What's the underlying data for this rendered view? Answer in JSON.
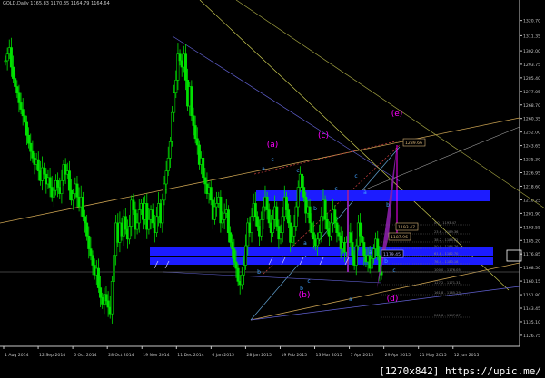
{
  "header": {
    "text": "GOLD,Daily  1165.83 1170.35 1164.79 1164.64"
  },
  "watermark": "[1270x842] https://upic.me/",
  "chart_data": {
    "type": "candlestick",
    "symbol": "GOLD",
    "timeframe": "Daily",
    "ohlc": {
      "open": 1165.83,
      "high": 1170.35,
      "low": 1164.79,
      "close": 1164.64
    },
    "ylim": [
      1120,
      1330
    ],
    "y_ticks": [
      "1320.70",
      "1311.35",
      "1302.00",
      "1293.75",
      "1285.40",
      "1277.05",
      "1268.70",
      "1260.35",
      "1252.00",
      "1243.65",
      "1235.30",
      "1226.95",
      "1218.60",
      "1210.25",
      "1201.90",
      "1193.55",
      "1185.20",
      "1176.85",
      "1168.50",
      "1160.15",
      "1151.80",
      "1143.45",
      "1135.10",
      "1126.75"
    ],
    "x_ticks": [
      "1 Aug 2014",
      "12 Sep 2014",
      "6 Oct 2014",
      "28 Oct 2014",
      "19 Nov 2014",
      "11 Dec 2014",
      "6 Jan 2015",
      "28 Jan 2015",
      "19 Feb 2015",
      "13 Mar 2015",
      "7 Apr 2015",
      "29 Apr 2015",
      "21 May 2015",
      "12 Jun 2015"
    ],
    "closes": [
      1296,
      1300,
      1304,
      1292,
      1285,
      1280,
      1276,
      1270,
      1266,
      1262,
      1258,
      1250,
      1245,
      1240,
      1236,
      1232,
      1235,
      1228,
      1222,
      1230,
      1226,
      1220,
      1224,
      1218,
      1212,
      1216,
      1222,
      1218,
      1214,
      1222,
      1232,
      1226,
      1228,
      1216,
      1210,
      1214,
      1220,
      1212,
      1206,
      1212,
      1200,
      1196,
      1188,
      1180,
      1176,
      1170,
      1164,
      1168,
      1156,
      1150,
      1146,
      1152,
      1148,
      1144,
      1140,
      1160,
      1176,
      1196,
      1184,
      1196,
      1188,
      1200,
      1192,
      1186,
      1194,
      1210,
      1204,
      1192,
      1196,
      1204,
      1208,
      1198,
      1208,
      1192,
      1198,
      1204,
      1196,
      1190,
      1200,
      1208,
      1196,
      1210,
      1220,
      1228,
      1236,
      1246,
      1264,
      1276,
      1284,
      1300,
      1296,
      1292,
      1300,
      1284,
      1268,
      1280,
      1262,
      1256,
      1248,
      1244,
      1232,
      1236,
      1224,
      1220,
      1214,
      1218,
      1210,
      1198,
      1206,
      1208,
      1212,
      1196,
      1198,
      1202,
      1204,
      1190,
      1184,
      1180,
      1172,
      1168,
      1160,
      1158,
      1164,
      1170,
      1182,
      1196,
      1190,
      1200,
      1208,
      1200,
      1194,
      1188,
      1198,
      1206,
      1212,
      1204,
      1196,
      1190,
      1198,
      1206,
      1194,
      1186,
      1190,
      1200,
      1212,
      1204,
      1196,
      1184,
      1188,
      1194,
      1206,
      1218,
      1226,
      1218,
      1212,
      1202,
      1206,
      1196,
      1190,
      1186,
      1182,
      1186,
      1190,
      1200,
      1210,
      1198,
      1192,
      1188,
      1196,
      1204,
      1196,
      1190,
      1188,
      1180,
      1184,
      1178,
      1184,
      1190,
      1184,
      1176,
      1170,
      1182,
      1196,
      1188,
      1184,
      1176,
      1172,
      1176,
      1168,
      1174,
      1180,
      1186,
      1176,
      1166,
      1164
    ],
    "annotations": [
      {
        "label": "(a)",
        "color": "#ff00ff"
      },
      {
        "label": "(b)",
        "color": "#ff00ff"
      },
      {
        "label": "(c)",
        "color": "#ff00ff"
      },
      {
        "label": "(d)",
        "color": "#ff00ff"
      },
      {
        "label": "(e)",
        "color": "#ff00ff"
      }
    ],
    "small_labels": [
      "a",
      "c",
      "b",
      "c",
      "a",
      "c",
      "a",
      "b",
      "a",
      "c",
      "b",
      "c",
      "b",
      "a",
      "c",
      "b"
    ],
    "price_tags": [
      {
        "text": "1239.66",
        "color": "#d8b478"
      },
      {
        "text": "1193.47",
        "color": "#d8b478"
      },
      {
        "text": "1187.96",
        "color": "#d8b478"
      },
      {
        "text": "1179.45",
        "color": "#b0b0ff"
      }
    ],
    "fib_labels": [
      {
        "text": "0.0 - 1193.47"
      },
      {
        "text": "23.6 - 1189.36"
      },
      {
        "text": "38.2 - 1186.82"
      },
      {
        "text": "50.0 - 1184.76"
      },
      {
        "text": "61.8 - 1182.70"
      },
      {
        "text": "76.4 - 1180.16"
      },
      {
        "text": "100.0 - 1176.05"
      },
      {
        "text": "127.2 - 1171.31"
      },
      {
        "text": "161.8 - 1165.29"
      },
      {
        "text": "261.8 - 1147.87"
      }
    ],
    "colors": {
      "bull": "#00e000",
      "bear": "#00e000",
      "background": "#000000",
      "axis": "#c8c8c8",
      "zone": "#1c1cff",
      "pattern": "#8a1ea8",
      "magenta": "#ff00ff"
    }
  }
}
